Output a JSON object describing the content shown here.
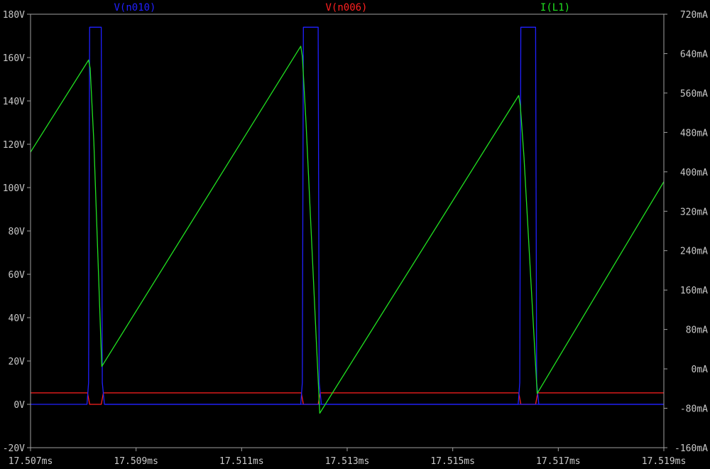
{
  "chart_data": {
    "type": "line",
    "title": "",
    "xlabel": "",
    "ylabel": "",
    "x_unit": "ms",
    "xlim": [
      17.507,
      17.519
    ],
    "x_ticks": [
      "17.507ms",
      "17.509ms",
      "17.511ms",
      "17.513ms",
      "17.515ms",
      "17.517ms",
      "17.519ms"
    ],
    "y_left_lim": [
      -20,
      180
    ],
    "y_left_ticks": [
      "-20V",
      "0V",
      "20V",
      "40V",
      "60V",
      "80V",
      "100V",
      "120V",
      "140V",
      "160V",
      "180V"
    ],
    "y_right_lim": [
      -160,
      720
    ],
    "y_right_ticks": [
      "-160mA",
      "-80mA",
      "0mA",
      "80mA",
      "160mA",
      "240mA",
      "320mA",
      "400mA",
      "480mA",
      "560mA",
      "640mA",
      "720mA"
    ],
    "grid": false,
    "legend_placement": "top",
    "colors": {
      "background": "#000000",
      "axes": "#a0a0a0",
      "text": "#c8c8c8"
    },
    "series": [
      {
        "name": "V(n010)",
        "axis": "left",
        "color": "#2020ff",
        "x": [
          17.507,
          17.50807,
          17.5081,
          17.50812,
          17.50834,
          17.50836,
          17.5084,
          17.519
        ],
        "y": [
          0,
          0,
          10,
          174,
          174,
          10,
          0,
          0
        ],
        "x2": [
          17.5084,
          17.51212,
          17.51215,
          17.51217,
          17.51245,
          17.51247,
          17.51251
        ],
        "y2": [
          0,
          0,
          10,
          174,
          174,
          10,
          0
        ]
      },
      {
        "name": "V(n006)",
        "axis": "left",
        "color": "#ff2020",
        "x": [
          17.507,
          17.50808,
          17.50812,
          17.50834,
          17.50838,
          17.51213,
          17.51217,
          17.51245,
          17.51249,
          17.51625,
          17.51629,
          17.51657,
          17.51661,
          17.519
        ],
        "y": [
          5.3,
          5.3,
          0,
          0,
          5.3,
          5.3,
          0,
          0,
          5.3,
          5.3,
          0,
          0,
          5.3,
          5.3
        ]
      },
      {
        "name": "I(L1)",
        "axis": "right",
        "color": "#20e020",
        "x": [
          17.507,
          17.5081,
          17.50813,
          17.5082,
          17.50835,
          17.51212,
          17.51215,
          17.51222,
          17.51248,
          17.51625,
          17.51628,
          17.51635,
          17.5166,
          17.519
        ],
        "y": [
          440,
          627,
          610,
          460,
          5,
          655,
          635,
          500,
          -90,
          555,
          535,
          430,
          -50,
          380
        ]
      }
    ],
    "series_vn010_extra": {
      "x": [
        17.51251,
        17.51624,
        17.51627,
        17.51629,
        17.51657,
        17.51659,
        17.51663,
        17.519
      ],
      "y": [
        0,
        0,
        10,
        174,
        174,
        10,
        0,
        0
      ]
    }
  }
}
